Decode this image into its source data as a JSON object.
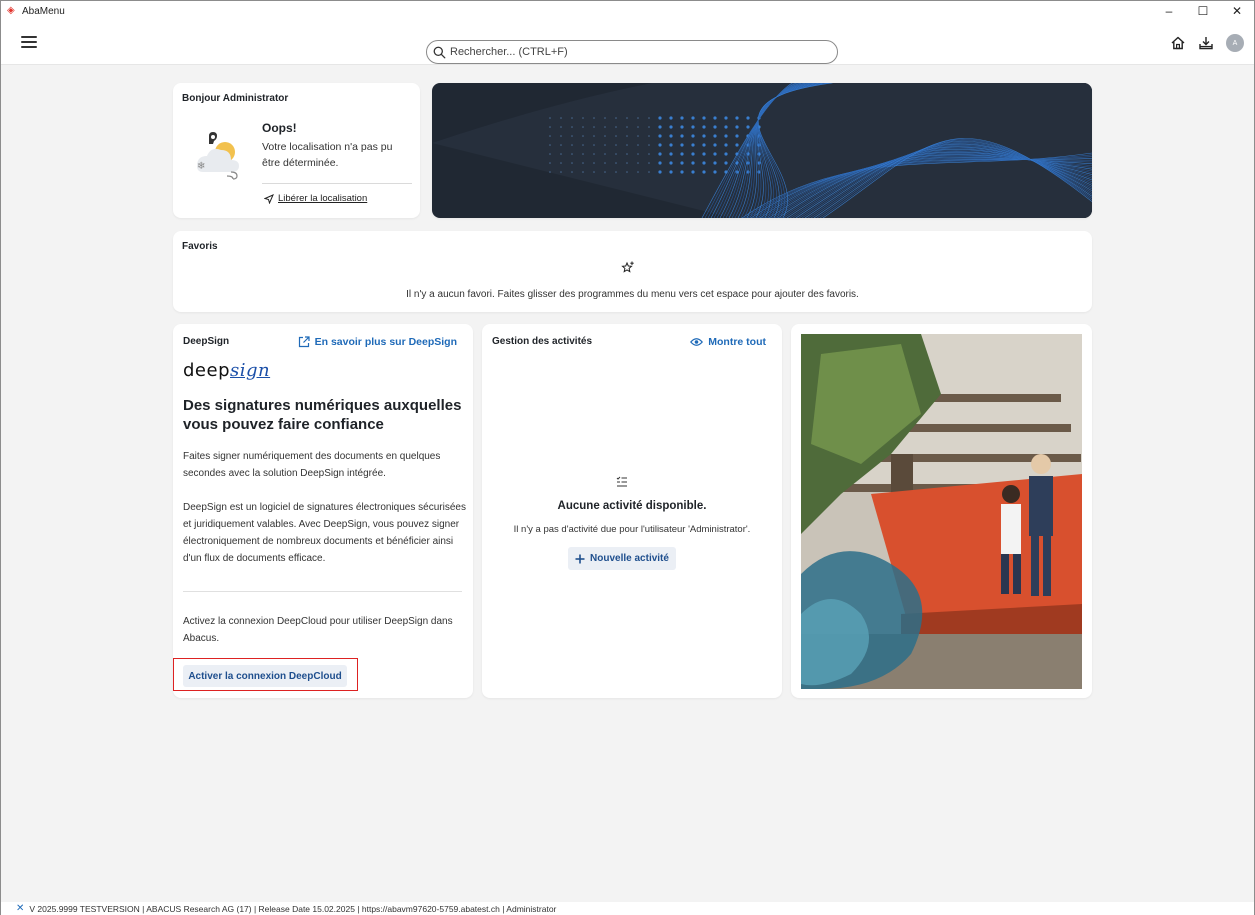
{
  "window": {
    "title": "AbaMenu",
    "controls": {
      "minimize": "–",
      "maximize": "☐",
      "close": "✕"
    }
  },
  "topbar": {
    "search_placeholder": "Rechercher... (CTRL+F)",
    "avatar_initial": "A",
    "icons": [
      "menu-icon",
      "search-icon",
      "home-icon",
      "download-icon",
      "avatar"
    ]
  },
  "greeting": {
    "title": "Bonjour Administrator",
    "oops": "Oops!",
    "message": "Votre localisation n'a pas pu être déterminée.",
    "location_link": "Libérer la localisation"
  },
  "favorites": {
    "title": "Favoris",
    "empty_text": "Il n'y a aucun favori. Faites glisser des programmes du menu vers cet espace pour ajouter des favoris."
  },
  "deepsign": {
    "title": "DeepSign",
    "learn_more": "En savoir plus sur DeepSign",
    "logo_deep": "deep",
    "logo_sign": "sign",
    "heading": "Des signatures numériques auxquelles vous pouvez faire confiance",
    "paragraph1": "Faites signer numériquement des documents en quelques secondes avec la solution DeepSign intégrée.",
    "paragraph2": "DeepSign est un logiciel de signatures électroniques sécurisées et juridiquement valables. Avec DeepSign, vous pouvez signer électroniquement de nombreux documents et bénéficier ainsi d'un flux de documents efficace.",
    "paragraph3": "Activez la connexion DeepCloud pour utiliser DeepSign dans Abacus.",
    "activate_button": "Activer la connexion DeepCloud"
  },
  "activities": {
    "title": "Gestion des activités",
    "show_all": "Montre tout",
    "empty_title": "Aucune activité disponible.",
    "empty_text": "Il n'y a pas d'activité due pour l'utilisateur 'Administrator'.",
    "new_button": "Nouvelle activité"
  },
  "status_bar": {
    "text": "V 2025.9999 TESTVERSION | ABACUS Research AG (17) | Release Date 15.02.2025 | https://abavm97620-5759.abatest.ch | Administrator"
  },
  "colors": {
    "accent": "#1f6ab8",
    "banner_bg": "#202833",
    "highlight_border": "#dd2222",
    "app_icon": "#e2322b"
  }
}
